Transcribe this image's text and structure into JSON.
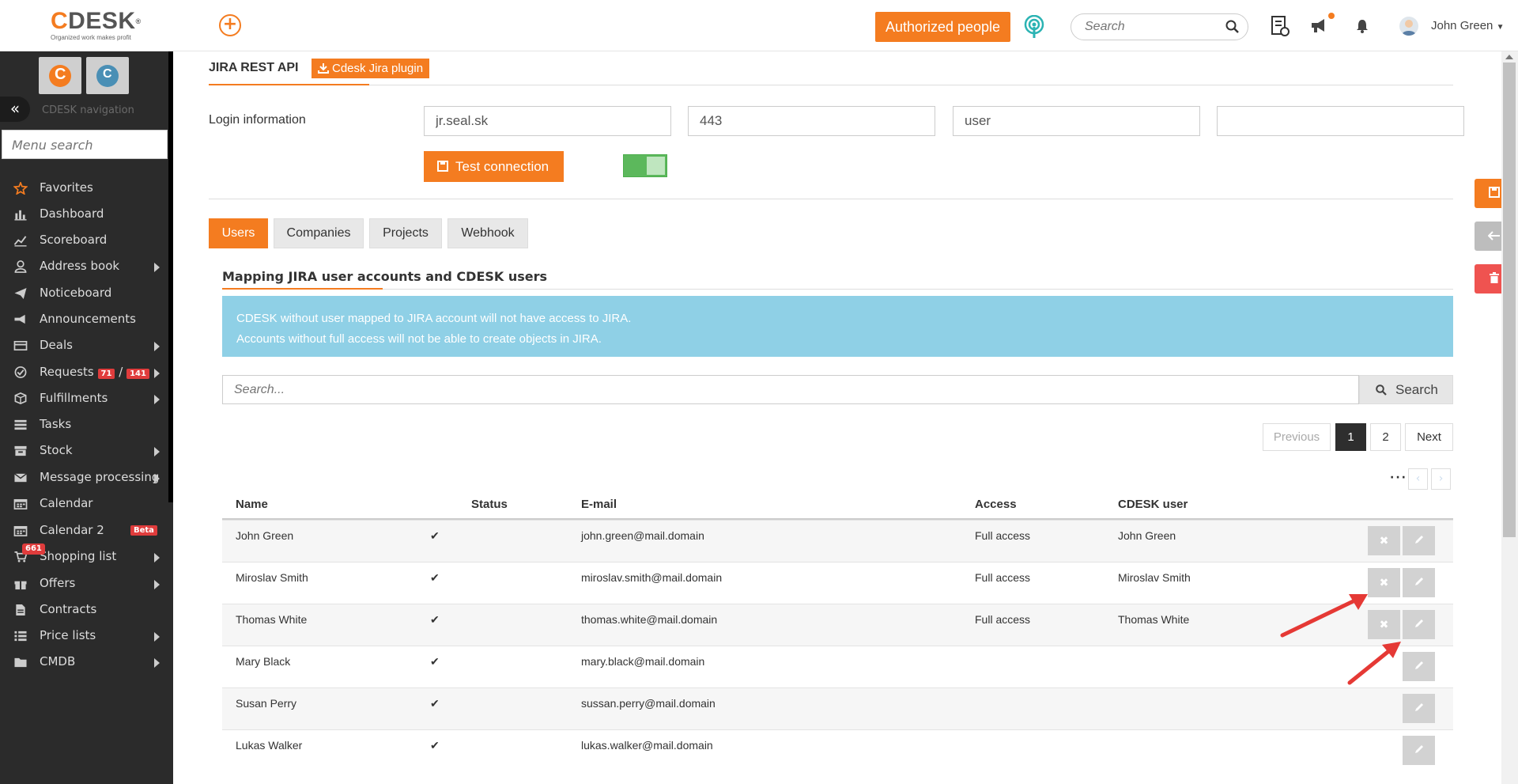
{
  "header": {
    "logo_text": "CDESK",
    "logo_tagline": "Organized work makes profit",
    "authorized_label": "Authorized people",
    "search_placeholder": "Search",
    "user_name": "John Green"
  },
  "sidebar": {
    "nav_label": "CDESK navigation",
    "menu_search_placeholder": "Menu search",
    "items": [
      {
        "label": "Favorites",
        "icon": "star-icon",
        "submenu": false
      },
      {
        "label": "Dashboard",
        "icon": "bar-chart-icon",
        "submenu": false
      },
      {
        "label": "Scoreboard",
        "icon": "line-chart-icon",
        "submenu": false
      },
      {
        "label": "Address book",
        "icon": "user-icon",
        "submenu": true
      },
      {
        "label": "Noticeboard",
        "icon": "paper-plane-icon",
        "submenu": false
      },
      {
        "label": "Announcements",
        "icon": "megaphone-icon",
        "submenu": false
      },
      {
        "label": "Deals",
        "icon": "credit-card-icon",
        "submenu": true
      },
      {
        "label": "Requests",
        "icon": "check-circle-icon",
        "submenu": true
      },
      {
        "label": "Fulfillments",
        "icon": "cube-icon",
        "submenu": true
      },
      {
        "label": "Tasks",
        "icon": "tasks-icon",
        "submenu": false
      },
      {
        "label": "Stock",
        "icon": "archive-icon",
        "submenu": true
      },
      {
        "label": "Message processing",
        "icon": "envelope-icon",
        "submenu": true
      },
      {
        "label": "Calendar",
        "icon": "calendar-icon",
        "submenu": false
      },
      {
        "label": "Calendar 2",
        "icon": "calendar-icon",
        "submenu": false
      },
      {
        "label": "Shopping list",
        "icon": "cart-icon",
        "submenu": true
      },
      {
        "label": "Offers",
        "icon": "gift-icon",
        "submenu": true
      },
      {
        "label": "Contracts",
        "icon": "file-icon",
        "submenu": false
      },
      {
        "label": "Price lists",
        "icon": "list-icon",
        "submenu": true
      },
      {
        "label": "CMDB",
        "icon": "folder-icon",
        "submenu": true
      }
    ],
    "requests_badge_1": "71",
    "requests_sep": "/",
    "requests_badge_2": "141",
    "message_badge": "661",
    "calendar2_badge": "Beta"
  },
  "jira": {
    "section_title": "JIRA REST API",
    "plugin_button": "Cdesk Jira plugin",
    "login_label": "Login information",
    "host": "jr.seal.sk",
    "port": "443",
    "user": "user",
    "password": "",
    "test_button": "Test connection",
    "toggle_on": true
  },
  "tabs": [
    {
      "label": "Users",
      "active": true
    },
    {
      "label": "Companies",
      "active": false
    },
    {
      "label": "Projects",
      "active": false
    },
    {
      "label": "Webhook",
      "active": false
    }
  ],
  "mapping": {
    "title": "Mapping JIRA user accounts and CDESK users",
    "info_line1": "CDESK without user mapped to JIRA account will not have access to JIRA.",
    "info_line2": "Accounts without full access will not be able to create objects in JIRA.",
    "search_placeholder": "Search...",
    "search_button": "Search",
    "pagination": {
      "previous": "Previous",
      "pages": [
        "1",
        "2"
      ],
      "current": "1",
      "next": "Next"
    },
    "columns": [
      "Name",
      "Status",
      "E-mail",
      "Access",
      "CDESK user"
    ],
    "rows": [
      {
        "name": "John Green",
        "status": "✔",
        "email": "john.green@mail.domain",
        "access": "Full access",
        "cdesk_user": "John Green",
        "deletable": true
      },
      {
        "name": "Miroslav Smith",
        "status": "✔",
        "email": "miroslav.smith@mail.domain",
        "access": "Full access",
        "cdesk_user": "Miroslav Smith",
        "deletable": true
      },
      {
        "name": "Thomas White",
        "status": "✔",
        "email": "thomas.white@mail.domain",
        "access": "Full access",
        "cdesk_user": "Thomas White",
        "deletable": true
      },
      {
        "name": "Mary Black",
        "status": "✔",
        "email": "mary.black@mail.domain",
        "access": "",
        "cdesk_user": "",
        "deletable": false
      },
      {
        "name": "Susan Perry",
        "status": "✔",
        "email": "sussan.perry@mail.domain",
        "access": "",
        "cdesk_user": "",
        "deletable": false
      },
      {
        "name": "Lukas Walker",
        "status": "✔",
        "email": "lukas.walker@mail.domain",
        "access": "",
        "cdesk_user": "",
        "deletable": false
      }
    ]
  },
  "colors": {
    "accent": "#f47c20",
    "sidebar_bg": "#2b2b2b",
    "info_bg": "#8fd0e6",
    "delete_red": "#ef5350",
    "back_grey": "#bdbdbd",
    "arrow_red": "#e53935"
  }
}
